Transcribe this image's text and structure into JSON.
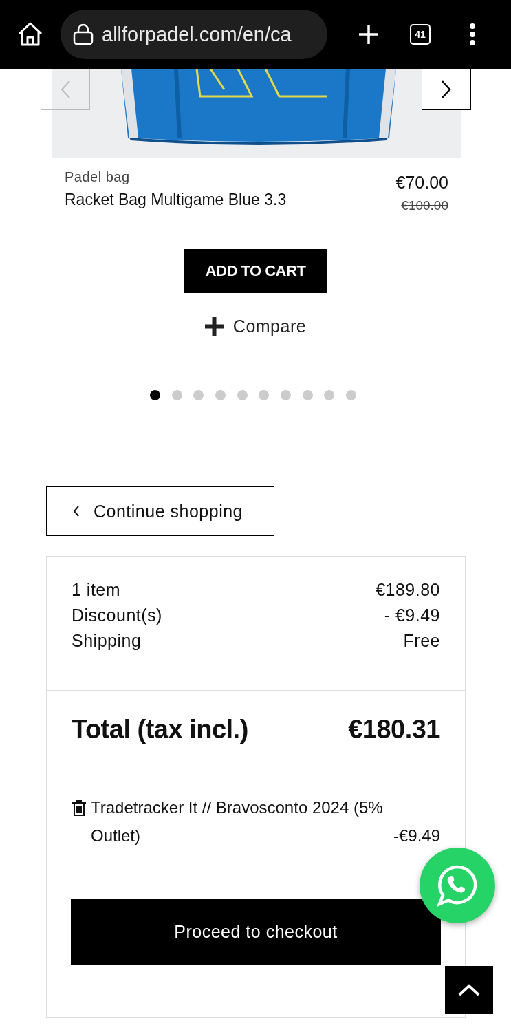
{
  "browser": {
    "url": "allforpadel.com/en/ca",
    "tab_count": "41"
  },
  "product": {
    "category": "Padel bag",
    "name": "Racket Bag Multigame Blue 3.3",
    "price": "€70.00",
    "old_price": "€100.00",
    "add_button": "ADD TO CART",
    "compare": "Compare"
  },
  "carousel_dots": [
    {
      "selected": true
    },
    {
      "selected": false
    },
    {
      "selected": false
    },
    {
      "selected": false
    },
    {
      "selected": false
    },
    {
      "selected": false
    },
    {
      "selected": false
    },
    {
      "selected": false
    },
    {
      "selected": false
    },
    {
      "selected": false
    }
  ],
  "continue_button": "Continue shopping",
  "summary": {
    "lines": [
      {
        "label": "1 item",
        "value": "€189.80"
      },
      {
        "label": "Discount(s)",
        "value": "- €9.49"
      },
      {
        "label": "Shipping",
        "value": "Free"
      }
    ],
    "total_label": "Total (tax incl.)",
    "total_value": "€180.31",
    "voucher": {
      "name": "Tradetracker It // Bravosconto 2024 (5% Outlet)",
      "value": "-€9.49"
    },
    "checkout_button": "Proceed to checkout"
  }
}
